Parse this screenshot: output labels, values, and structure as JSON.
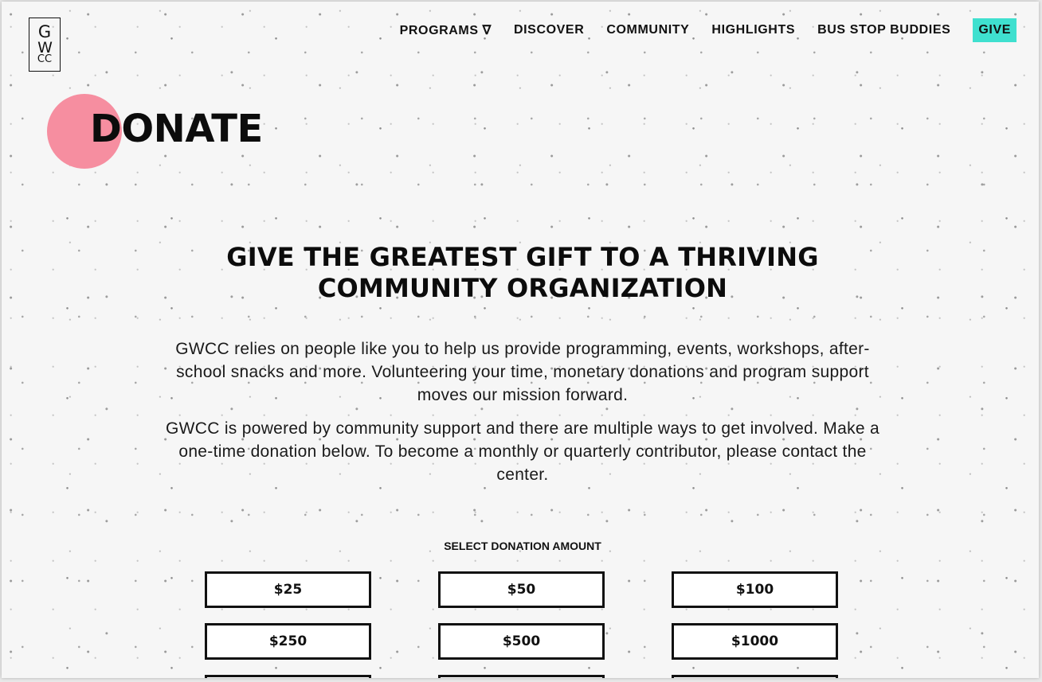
{
  "logo": {
    "line1": "G",
    "line2": "W",
    "line3": "CC"
  },
  "nav": {
    "items": [
      "PROGRAMS ∇",
      "DISCOVER",
      "COMMUNITY",
      "HIGHLIGHTS",
      "BUS STOP BUDDIES"
    ],
    "give": "GIVE"
  },
  "colors": {
    "accent_circle": "#f68ea0",
    "give_button": "#3fe0cf"
  },
  "page_title": "DONATE",
  "headline": {
    "line1": "GIVE THE GREATEST GIFT TO A THRIVING",
    "line2": "COMMUNITY ORGANIZATION"
  },
  "paragraph1": "GWCC relies on people like you to help us provide programming, events, workshops, after-school snacks and more. Volunteering your time, monetary donations and program support moves our mission forward.",
  "paragraph2": "GWCC is powered by community support and there are multiple ways to get involved. Make a one-time donation below. To become a monthly or quarterly contributor, please contact the center.",
  "donation": {
    "label": "SELECT DONATION AMOUNT",
    "amounts": [
      "$25",
      "$50",
      "$100",
      "$250",
      "$500",
      "$1000"
    ]
  }
}
